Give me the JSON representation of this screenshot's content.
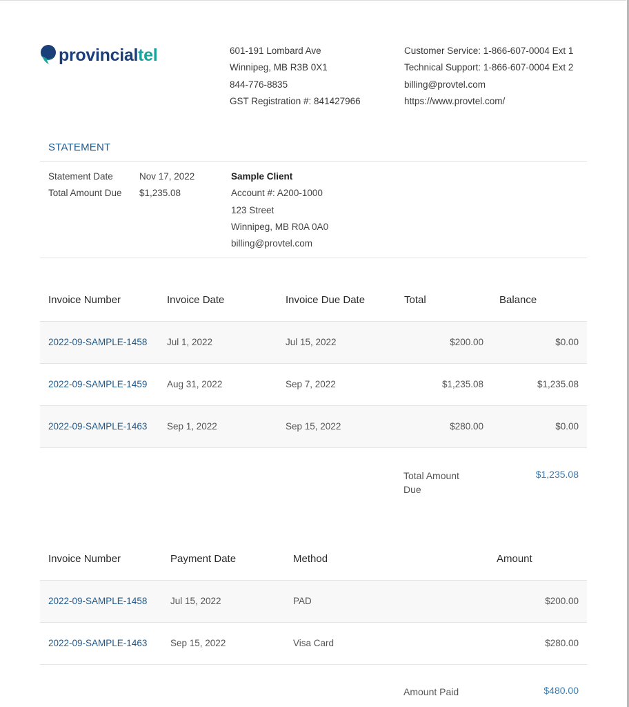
{
  "brand": {
    "name_part1": "provincial",
    "name_part2": "tel",
    "color_primary": "#1b3f78",
    "color_accent": "#1aa39a"
  },
  "company_address": [
    "601-191 Lombard Ave",
    "Winnipeg, MB R3B 0X1",
    "844-776-8835",
    "GST Registration #: 841427966"
  ],
  "company_contact": [
    "Customer Service: 1-866-607-0004 Ext 1",
    "Technical Support: 1-866-607-0004 Ext 2",
    "billing@provtel.com",
    "https://www.provtel.com/"
  ],
  "statement": {
    "title": "STATEMENT",
    "date_label": "Statement Date",
    "date_value": "Nov 17, 2022",
    "due_label": "Total Amount Due",
    "due_value": "$1,235.08"
  },
  "client": {
    "name": "Sample Client",
    "account": "Account #: A200-1000",
    "street": "123 Street",
    "city": "Winnipeg, MB R0A 0A0",
    "email": "billing@provtel.com"
  },
  "invoices": {
    "headers": [
      "Invoice Number",
      "Invoice Date",
      "Invoice Due Date",
      "Total",
      "Balance"
    ],
    "rows": [
      {
        "number": "2022-09-SAMPLE-1458",
        "date": "Jul 1, 2022",
        "due": "Jul 15, 2022",
        "total": "$200.00",
        "balance": "$0.00"
      },
      {
        "number": "2022-09-SAMPLE-1459",
        "date": "Aug 31, 2022",
        "due": "Sep 7, 2022",
        "total": "$1,235.08",
        "balance": "$1,235.08"
      },
      {
        "number": "2022-09-SAMPLE-1463",
        "date": "Sep 1, 2022",
        "due": "Sep 15, 2022",
        "total": "$280.00",
        "balance": "$0.00"
      }
    ],
    "summary_label": "Total Amount Due",
    "summary_value": "$1,235.08"
  },
  "payments": {
    "headers": [
      "Invoice Number",
      "Payment Date",
      "Method",
      "Amount"
    ],
    "rows": [
      {
        "number": "2022-09-SAMPLE-1458",
        "date": "Jul 15, 2022",
        "method": "PAD",
        "amount": "$200.00"
      },
      {
        "number": "2022-09-SAMPLE-1463",
        "date": "Sep 15, 2022",
        "method": "Visa Card",
        "amount": "$280.00"
      }
    ],
    "summary_label": "Amount Paid",
    "summary_value": "$480.00"
  }
}
